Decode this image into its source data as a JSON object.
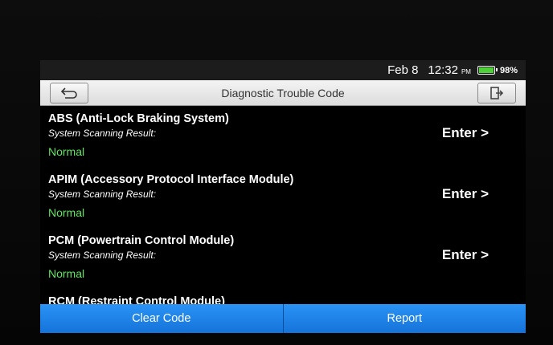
{
  "status": {
    "date": "Feb 8",
    "time": "12:32",
    "ampm": "PM",
    "battery_level": 0.98,
    "battery_percent": "98%"
  },
  "titlebar": {
    "title": "Diagnostic Trouble Code",
    "back_icon": "back-arrow-icon",
    "exit_icon": "exit-door-icon"
  },
  "modules": [
    {
      "name": "ABS (Anti-Lock Braking System)",
      "label": "System Scanning Result:",
      "result": "Normal",
      "action": "Enter >"
    },
    {
      "name": "APIM (Accessory Protocol Interface Module)",
      "label": "System Scanning Result:",
      "result": "Normal",
      "action": "Enter >"
    },
    {
      "name": "PCM (Powertrain Control Module)",
      "label": "System Scanning Result:",
      "result": "Normal",
      "action": "Enter >"
    },
    {
      "name": "RCM (Restraint Control Module)"
    }
  ],
  "footer": {
    "clear_label": "Clear Code",
    "report_label": "Report"
  },
  "colors": {
    "accent": "#1a7fe8",
    "normal": "#5fe65f",
    "battery": "#4fd03a"
  }
}
